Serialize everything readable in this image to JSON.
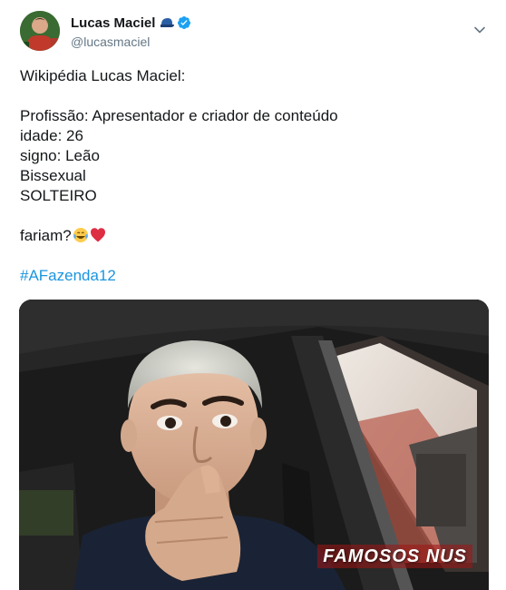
{
  "author": {
    "name": "Lucas Maciel",
    "handle": "@lucasmaciel",
    "name_badge_icon": "cap-icon",
    "verified_icon": "verified-badge-icon"
  },
  "menu_icon": "chevron-down-icon",
  "tweet": {
    "lines": [
      "Wikipédia Lucas Maciel:",
      "",
      "Profissão: Apresentador e criador de conteúdo",
      "idade: 26",
      "signo: Leão",
      "Bissexual",
      "SOLTEIRO",
      ""
    ],
    "closing_text": "fariam?",
    "closing_emojis": [
      "face-with-tears-of-joy-icon",
      "red-heart-icon"
    ],
    "hashtag": "#AFazenda12"
  },
  "media": {
    "watermark": "FAMOSOS NUS"
  },
  "colors": {
    "text": "#14171a",
    "handle": "#657786",
    "link": "#1b95e0",
    "verified": "#1da1f2"
  }
}
